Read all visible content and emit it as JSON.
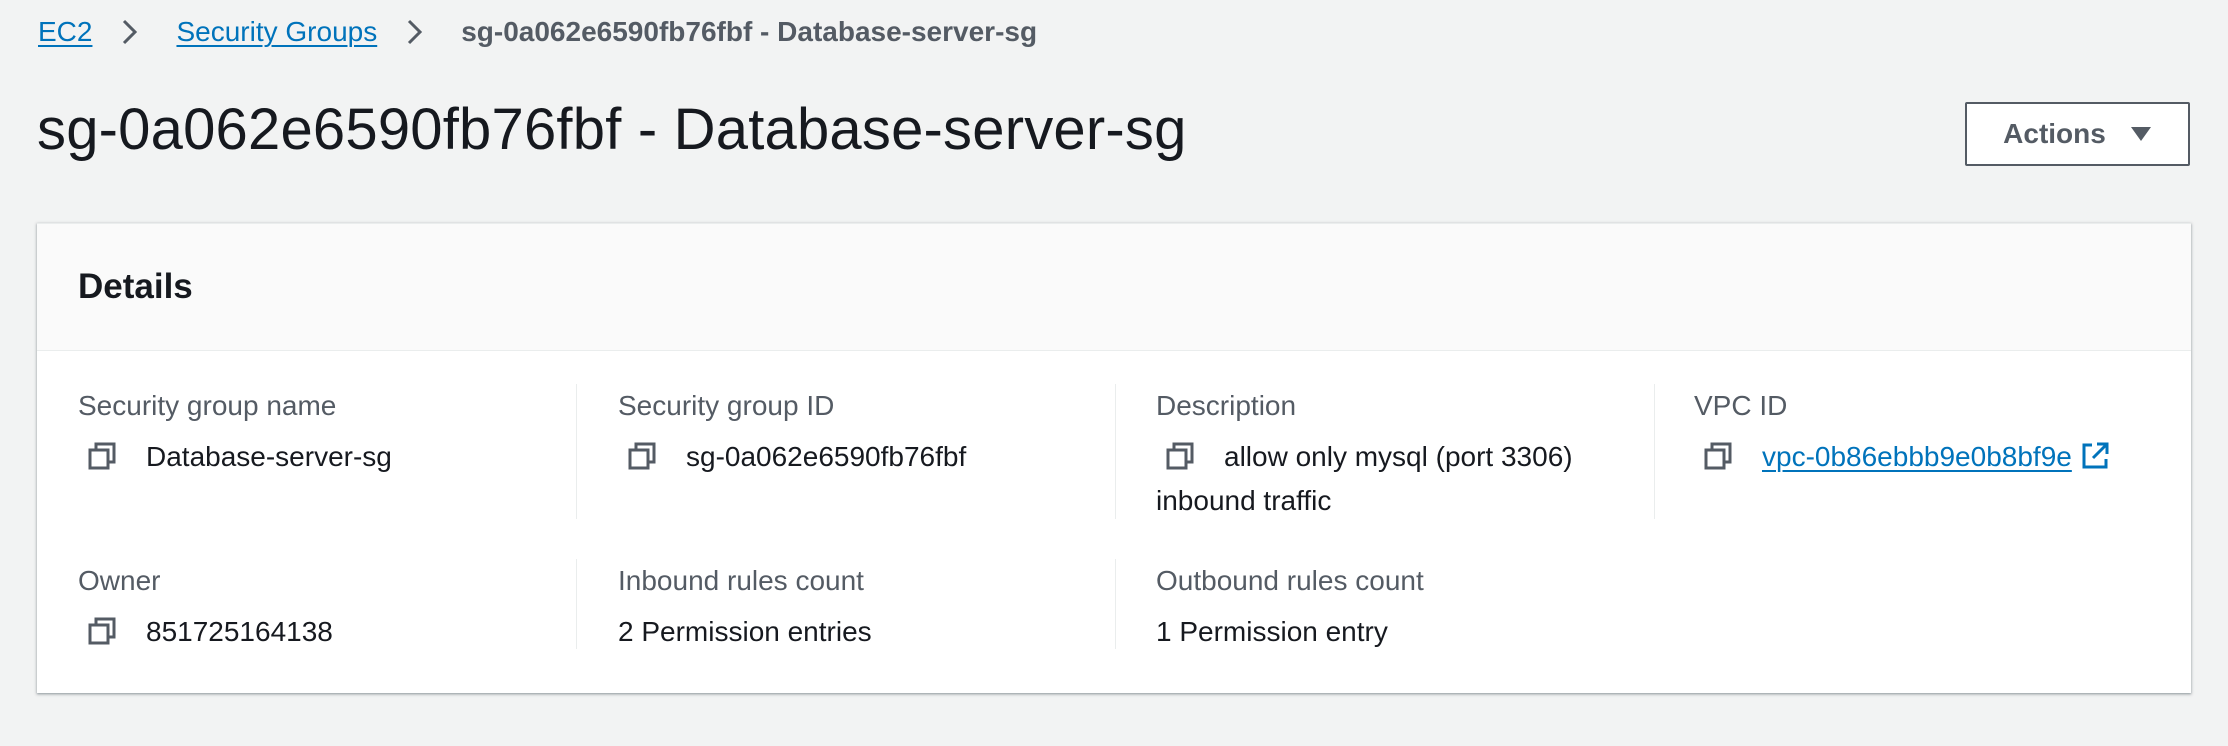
{
  "breadcrumb": {
    "items": [
      {
        "label": "EC2"
      },
      {
        "label": "Security Groups"
      }
    ],
    "current": "sg-0a062e6590fb76fbf - Database-server-sg"
  },
  "page": {
    "title": "sg-0a062e6590fb76fbf - Database-server-sg"
  },
  "actions": {
    "label": "Actions"
  },
  "details": {
    "heading": "Details",
    "fields": {
      "sg_name": {
        "label": "Security group name",
        "value": "Database-server-sg"
      },
      "sg_id": {
        "label": "Security group ID",
        "value": "sg-0a062e6590fb76fbf"
      },
      "description": {
        "label": "Description",
        "value": "allow only mysql (port 3306) inbound traffic"
      },
      "vpc_id": {
        "label": "VPC ID",
        "value": "vpc-0b86ebbb9e0b8bf9e"
      },
      "owner": {
        "label": "Owner",
        "value": "851725164138"
      },
      "inbound": {
        "label": "Inbound rules count",
        "value": "2 Permission entries"
      },
      "outbound": {
        "label": "Outbound rules count",
        "value": "1 Permission entry"
      }
    }
  },
  "colors": {
    "link": "#0073bb",
    "text": "#16191f",
    "muted": "#545b64",
    "background": "#f2f3f3"
  },
  "icons": [
    "chevron-right-icon",
    "caret-down-icon",
    "copy-icon",
    "external-link-icon"
  ]
}
